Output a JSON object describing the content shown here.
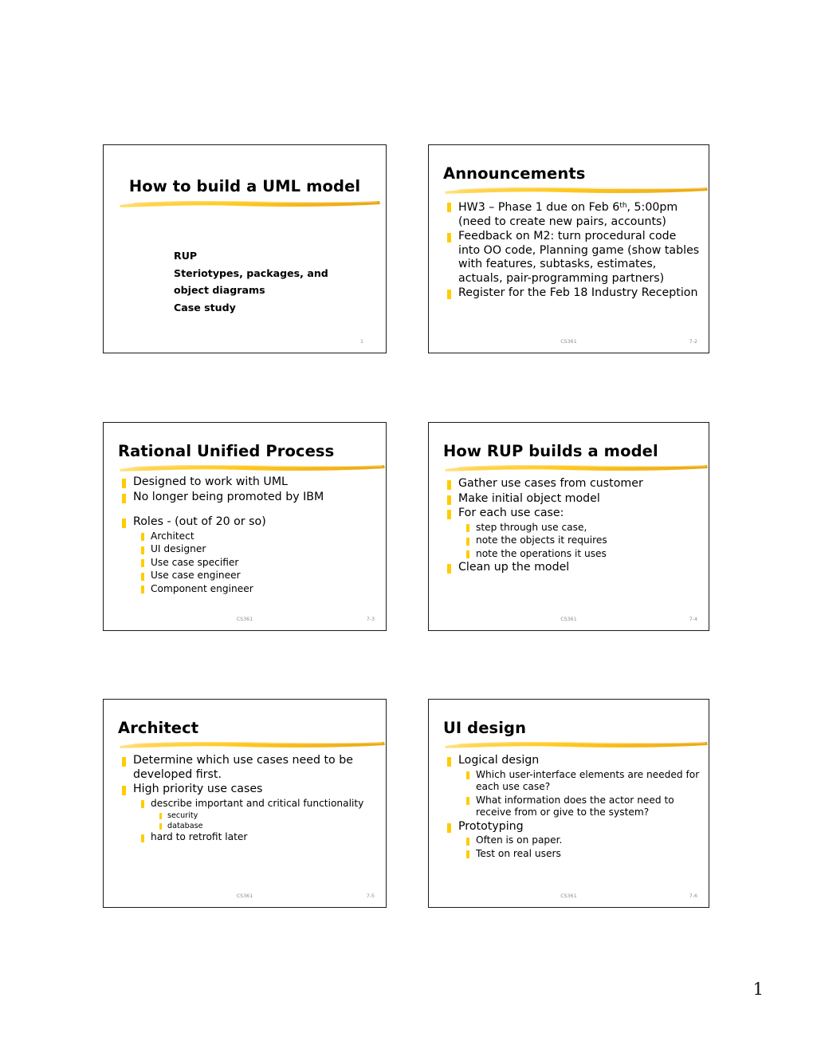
{
  "document": {
    "page_number": "1",
    "accent_color": "#FFCC00",
    "brush_color_start": "#FFD84D",
    "brush_color_end": "#E8A317"
  },
  "slides": [
    {
      "id": "slide-1",
      "title": "How to build a UML model",
      "title_align": "center",
      "sublines": [
        "RUP",
        "Steriotypes, packages, and",
        "object diagrams",
        "Case study"
      ],
      "footer": {
        "course": "",
        "number": "1",
        "solo": true
      }
    },
    {
      "id": "slide-2",
      "title": "Announcements",
      "title_align": "left",
      "bullets": [
        {
          "level": 1,
          "html": "HW3 – Phase 1 due on Feb 6<sup>th</sup>, 5:00pm (need to create new pairs, accounts)"
        },
        {
          "level": 1,
          "html": "Feedback on M2: turn procedural code into OO code, Planning game (show tables with features, subtasks, estimates, actuals, pair-programming partners)"
        },
        {
          "level": 1,
          "html": "Register for the Feb 18 Industry Reception"
        }
      ],
      "footer": {
        "course": "CS361",
        "number": "7-2",
        "solo": false
      }
    },
    {
      "id": "slide-3",
      "title": "Rational Unified Process",
      "title_align": "left",
      "bullets": [
        {
          "level": 1,
          "html": "Designed to work with UML"
        },
        {
          "level": 1,
          "html": "No longer being promoted by IBM"
        },
        {
          "level": 0,
          "html": ""
        },
        {
          "level": 1,
          "html": "Roles - (out of 20 or so)"
        },
        {
          "level": 2,
          "html": "Architect"
        },
        {
          "level": 2,
          "html": "UI designer"
        },
        {
          "level": 2,
          "html": "Use case specifier"
        },
        {
          "level": 2,
          "html": "Use case engineer"
        },
        {
          "level": 2,
          "html": "Component engineer"
        }
      ],
      "footer": {
        "course": "CS361",
        "number": "7-3",
        "solo": false
      }
    },
    {
      "id": "slide-4",
      "title": "How RUP builds a model",
      "title_align": "left",
      "bullets": [
        {
          "level": 1,
          "html": "Gather use cases from customer"
        },
        {
          "level": 1,
          "html": "Make initial object model"
        },
        {
          "level": 1,
          "html": "For each use case:"
        },
        {
          "level": 2,
          "html": "step through use case,"
        },
        {
          "level": 2,
          "html": "note the objects it requires"
        },
        {
          "level": 2,
          "html": "note the operations it uses"
        },
        {
          "level": 1,
          "html": "Clean up the model"
        }
      ],
      "footer": {
        "course": "CS361",
        "number": "7-4",
        "solo": false
      }
    },
    {
      "id": "slide-5",
      "title": "Architect",
      "title_align": "left",
      "bullets": [
        {
          "level": 1,
          "html": "Determine which use cases need to be developed first."
        },
        {
          "level": 1,
          "html": "High priority use cases"
        },
        {
          "level": 2,
          "html": "describe important and critical functionality"
        },
        {
          "level": 3,
          "html": "security"
        },
        {
          "level": 3,
          "html": "database"
        },
        {
          "level": 2,
          "html": "hard to retrofit later"
        }
      ],
      "footer": {
        "course": "CS361",
        "number": "7-5",
        "solo": false
      }
    },
    {
      "id": "slide-6",
      "title": "UI design",
      "title_align": "left",
      "bullets": [
        {
          "level": 1,
          "html": "Logical design"
        },
        {
          "level": 2,
          "html": "Which user-interface elements are needed for each use case?"
        },
        {
          "level": 2,
          "html": "What information does the actor need to receive from or give to the system?"
        },
        {
          "level": 1,
          "html": "Prototyping"
        },
        {
          "level": 2,
          "html": "Often is on paper."
        },
        {
          "level": 2,
          "html": "Test on real users"
        }
      ],
      "footer": {
        "course": "CS361",
        "number": "7-6",
        "solo": false
      }
    }
  ]
}
